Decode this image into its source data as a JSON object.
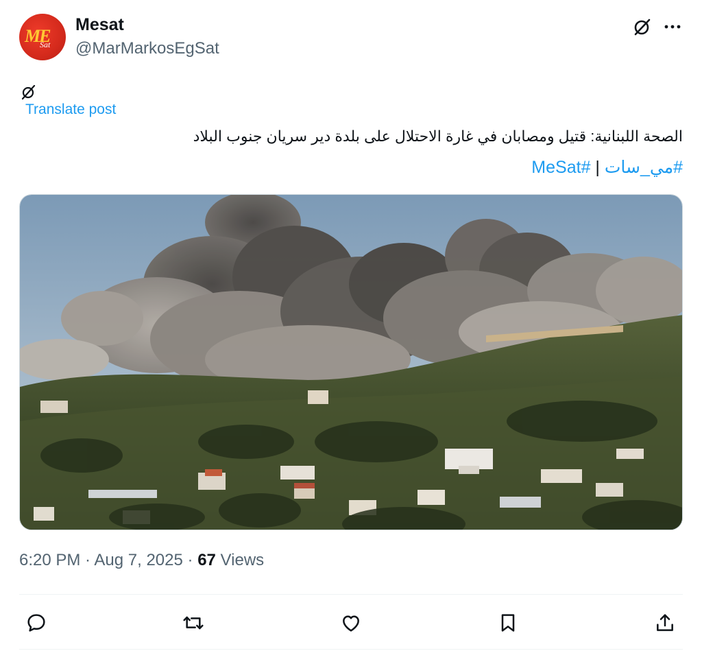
{
  "author": {
    "display_name": "Mesat",
    "handle": "@MarMarkosEgSat",
    "avatar_text": "ME",
    "avatar_subtext": "Sat"
  },
  "translate": {
    "label": "Translate post"
  },
  "post": {
    "text": "الصحة اللبنانية: قتيل ومصابان في غارة الاحتلال على بلدة دير سريان جنوب البلاد",
    "hashtag_1": "#مي_سات",
    "separator": " | ",
    "hashtag_2": "#MeSat"
  },
  "meta": {
    "time": "6:20 PM",
    "dot1": " · ",
    "date": "Aug 7, 2025",
    "dot2": " · ",
    "views_count": "67",
    "views_label": " Views"
  },
  "icons": {
    "grok": "grok-icon",
    "more": "more-icon",
    "reply": "reply-icon",
    "repost": "repost-icon",
    "like": "heart-icon",
    "bookmark": "bookmark-icon",
    "share": "share-icon"
  },
  "colors": {
    "link": "#1d9bf0",
    "text": "#0f1419",
    "secondary": "#536471",
    "avatar": "#d42a1c"
  }
}
